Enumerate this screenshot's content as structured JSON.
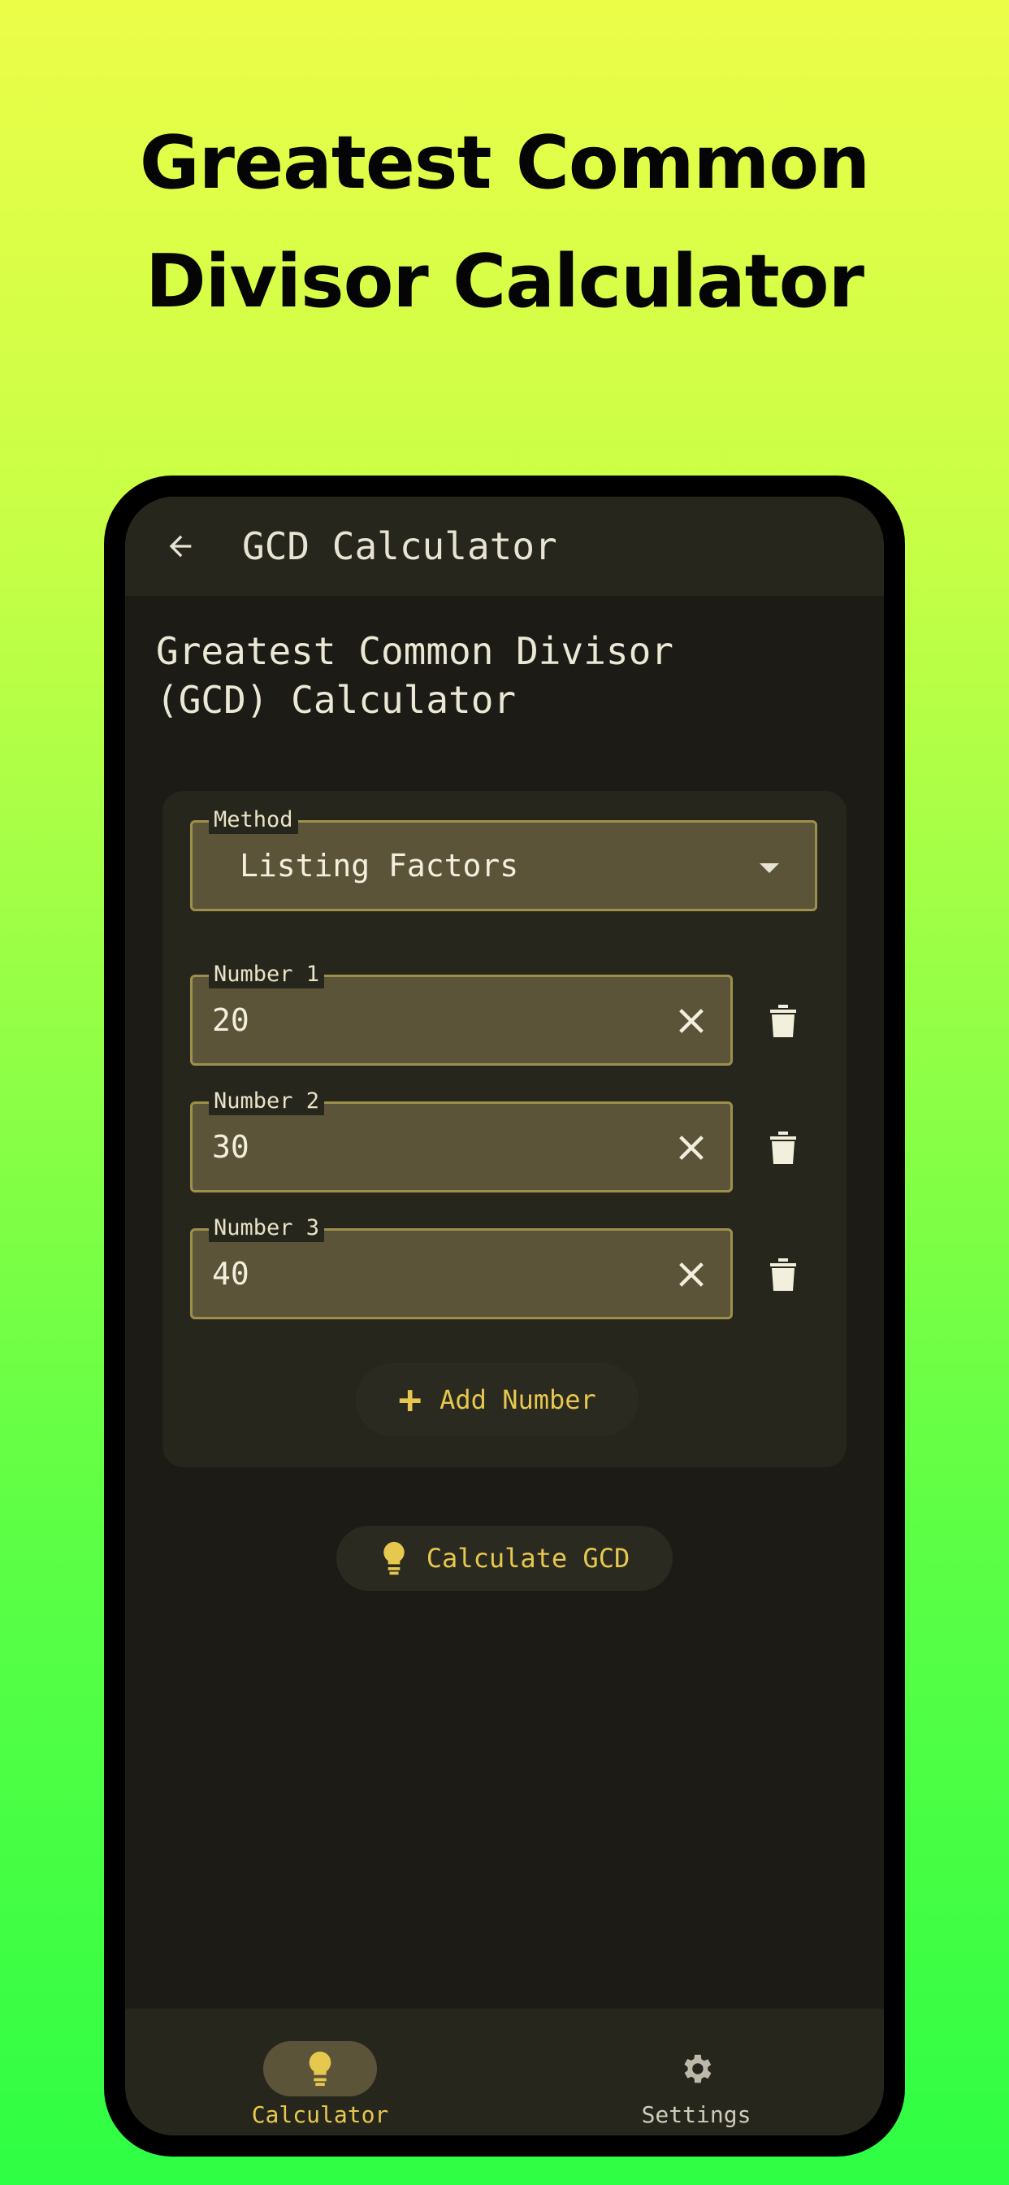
{
  "promo": {
    "title_line1": "Greatest Common",
    "title_line2": "Divisor Calculator"
  },
  "appbar": {
    "title": "GCD Calculator",
    "back_icon": "arrow-left-icon"
  },
  "page": {
    "heading_line1": "Greatest Common Divisor",
    "heading_line2": "(GCD) Calculator"
  },
  "method": {
    "label": "Method",
    "value": "Listing Factors"
  },
  "numbers": [
    {
      "label": "Number 1",
      "value": "20"
    },
    {
      "label": "Number 2",
      "value": "30"
    },
    {
      "label": "Number 3",
      "value": "40"
    }
  ],
  "buttons": {
    "add_number": "Add Number",
    "calculate": "Calculate GCD"
  },
  "nav": {
    "items": [
      {
        "label": "Calculator",
        "icon": "lightbulb-icon",
        "active": true
      },
      {
        "label": "Settings",
        "icon": "gear-icon",
        "active": false
      }
    ]
  },
  "colors": {
    "accent": "#e6c84e",
    "surface": "#27261d",
    "background": "#1c1b15",
    "field_fill": "#5b5439",
    "field_border": "#9c904c"
  }
}
